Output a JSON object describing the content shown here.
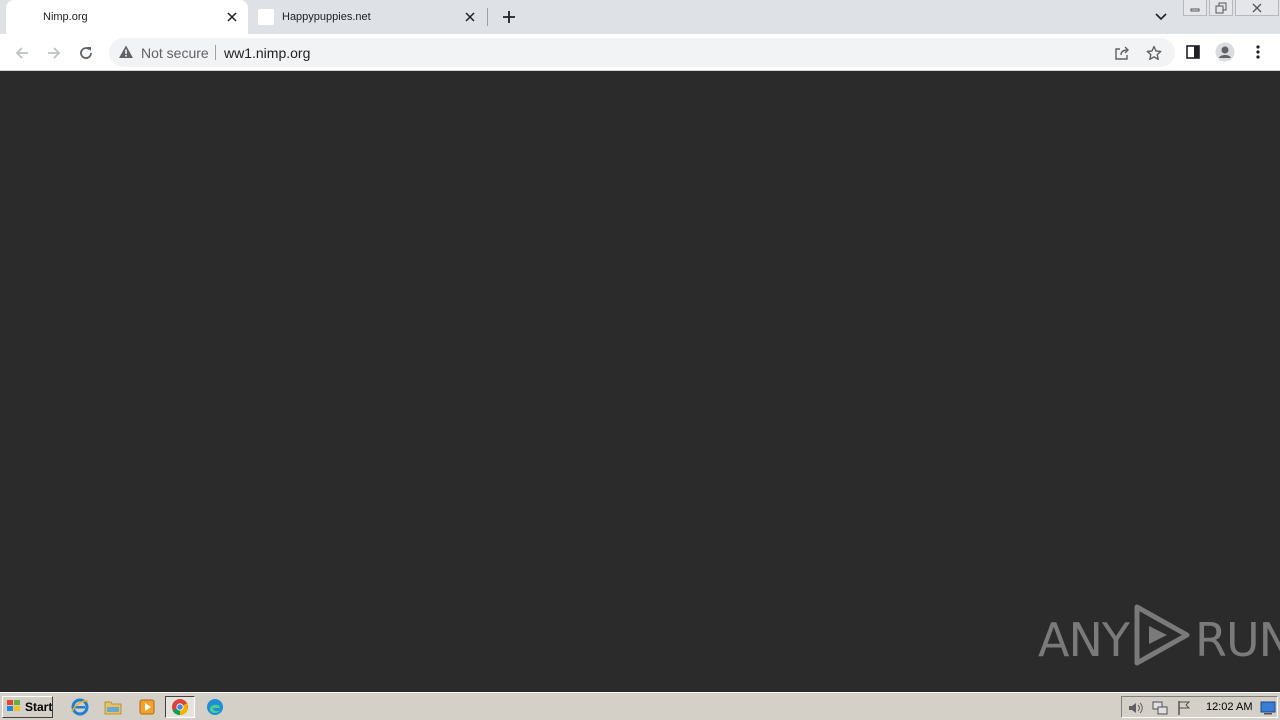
{
  "tabs": [
    {
      "title": "Nimp.org",
      "active": true
    },
    {
      "title": "Happypuppies.net",
      "active": false
    }
  ],
  "window_controls": [
    "minimize-icon",
    "restore-icon",
    "close-icon"
  ],
  "omnibox": {
    "security_status": "Not secure",
    "url": "ww1.nimp.org"
  },
  "toolbar_icons": [
    "share-icon",
    "bookmark-star-icon",
    "side-panel-icon",
    "profile-icon",
    "menu-icon"
  ],
  "content": {
    "background": "#2b2b2b"
  },
  "watermark": {
    "left": "ANY",
    "right": "RUN"
  },
  "taskbar": {
    "start_label": "Start",
    "apps": [
      "internet-explorer-icon",
      "file-explorer-icon",
      "media-player-icon",
      "chrome-icon",
      "edge-icon"
    ],
    "tray_icons": [
      "volume-icon",
      "network-icon",
      "action-center-flag-icon",
      "show-desktop-icon"
    ],
    "clock": "12:02 AM"
  },
  "colors": {
    "tabstrip": "#dee1e6",
    "toolbar": "#ffffff",
    "omnibox": "#f1f3f4",
    "taskbar": "#d4d0c8"
  }
}
